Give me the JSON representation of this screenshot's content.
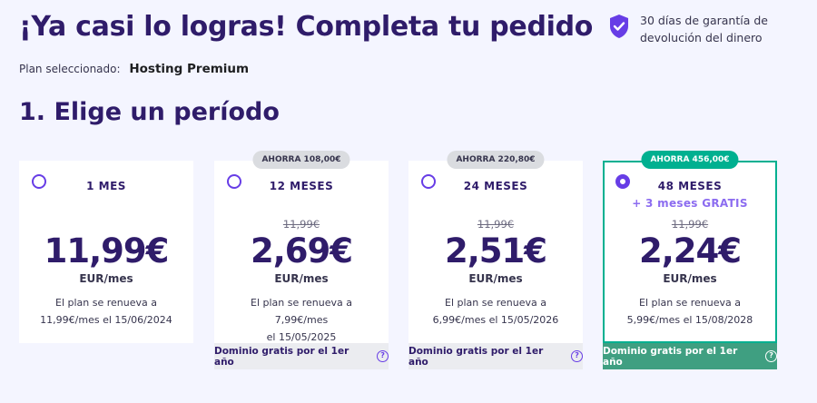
{
  "header": {
    "title": "¡Ya casi lo logras! Completa tu pedido",
    "guarantee_line1": "30 días de garantía de",
    "guarantee_line2": "devolución del dinero"
  },
  "plan": {
    "label": "Plan seleccionado:",
    "name": "Hosting Premium"
  },
  "section_title": "1. Elige un período",
  "colors": {
    "accent": "#673de6",
    "dark": "#2f1c6a",
    "green": "#00b090",
    "background": "#f4f5ff"
  },
  "cards": [
    {
      "badge": "",
      "period": "1 MES",
      "bonus": "",
      "old_price": "",
      "price": "11,99€",
      "unit": "EUR/mes",
      "renew_line1": "El plan se renueva a",
      "renew_line2": "11,99€/mes el 15/06/2024",
      "domain": "",
      "selected": false
    },
    {
      "badge": "AHORRA 108,00€",
      "period": "12 MESES",
      "bonus": "",
      "old_price": "11,99€",
      "price": "2,69€",
      "unit": "EUR/mes",
      "renew_line1": "El plan se renueva a 7,99€/mes",
      "renew_line2": "el 15/05/2025",
      "domain": "Dominio gratis por el 1er año",
      "selected": false
    },
    {
      "badge": "AHORRA 220,80€",
      "period": "24 MESES",
      "bonus": "",
      "old_price": "11,99€",
      "price": "2,51€",
      "unit": "EUR/mes",
      "renew_line1": "El plan se renueva a",
      "renew_line2": "6,99€/mes el 15/05/2026",
      "domain": "Dominio gratis por el 1er año",
      "selected": false
    },
    {
      "badge": "AHORRA 456,00€",
      "period": "48 MESES",
      "bonus": "+ 3 meses GRATIS",
      "old_price": "11,99€",
      "price": "2,24€",
      "unit": "EUR/mes",
      "renew_line1": "El plan se renueva a",
      "renew_line2": "5,99€/mes el 15/08/2028",
      "domain": "Dominio gratis por el 1er año",
      "selected": true
    }
  ],
  "icons": {
    "guarantee": "shield-check-icon",
    "help": "question-circle-icon"
  }
}
